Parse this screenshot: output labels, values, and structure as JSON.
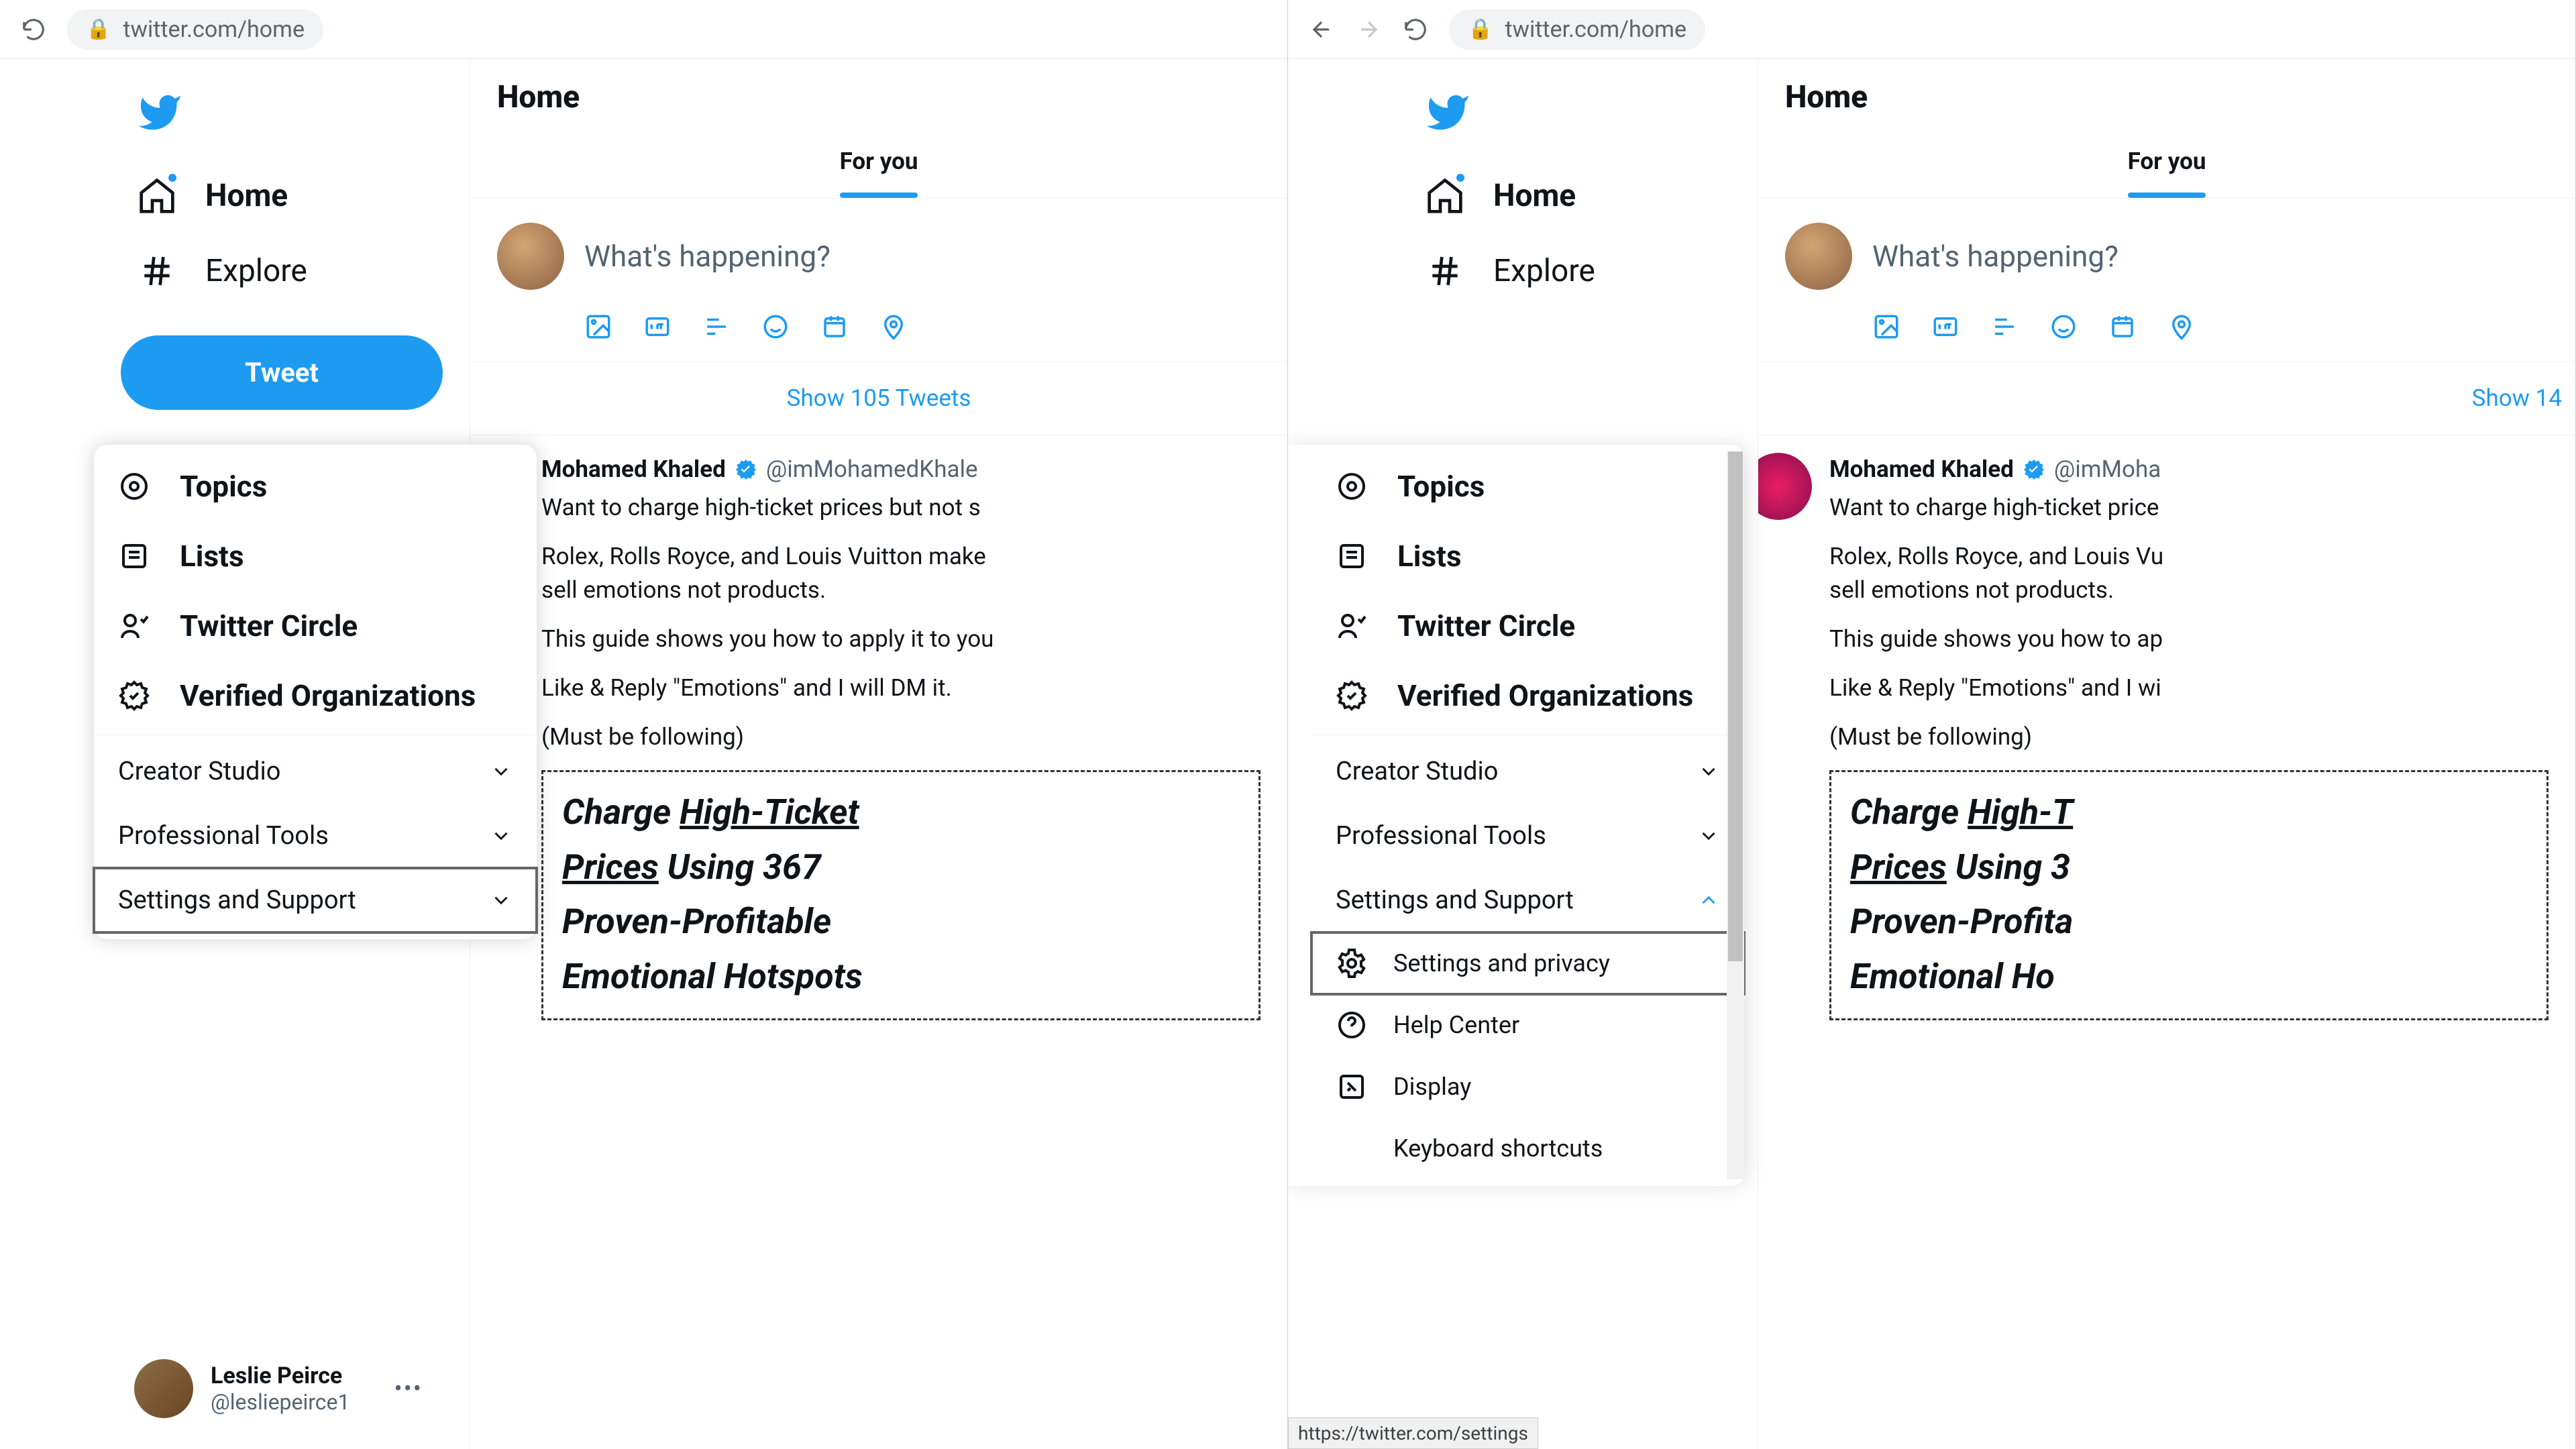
{
  "url": "twitter.com/home",
  "page_title": "Home",
  "sidebar": {
    "home": "Home",
    "explore": "Explore"
  },
  "popover": {
    "topics": "Topics",
    "lists": "Lists",
    "circle": "Twitter Circle",
    "verified": "Verified Organizations",
    "creator": "Creator Studio",
    "protools": "Professional Tools",
    "settings": "Settings and Support",
    "sub_settings_privacy": "Settings and privacy",
    "sub_help": "Help Center",
    "sub_display": "Display",
    "sub_shortcuts": "Keyboard shortcuts"
  },
  "tweet_btn": "Tweet",
  "profile": {
    "name": "Leslie Peirce",
    "handle": "@lesliepeirce1"
  },
  "tabs": {
    "foryou": "For you"
  },
  "compose_placeholder": "What's happening?",
  "show_left": "Show 105 Tweets",
  "show_right": "Show 14",
  "tweet": {
    "name": "Mohamed Khaled",
    "handle_left": "@imMohamedKhale",
    "handle_right": "@imMoha",
    "l1_left": "Want to charge high-ticket prices but not s",
    "l1_right": "Want to charge high-ticket price",
    "l2_left": "Rolex, Rolls Royce, and Louis Vuitton make",
    "l2_right": "Rolex, Rolls Royce, and Louis Vu",
    "l3": "sell emotions not products.",
    "l4_left": "This guide shows you how to apply it to you",
    "l4_right": "This guide shows you how to ap",
    "l5_left": "Like & Reply \"Emotions\" and I will DM it.",
    "l5_right": "Like & Reply \"Emotions\" and I wi",
    "l6": "(Must be following)",
    "embed1": "Charge ",
    "embed2_left": "High-Ticket",
    "embed2_right": "High-T",
    "embed3": "Prices",
    "embed4_left": " Using 367",
    "embed4_right": " Using 3",
    "embed5_left": "Proven-Profitable",
    "embed5_right": "Proven-Profita",
    "embed6_left": "Emotional Hotspots",
    "embed6_right": "Emotional Ho"
  },
  "status_url": "https://twitter.com/settings"
}
